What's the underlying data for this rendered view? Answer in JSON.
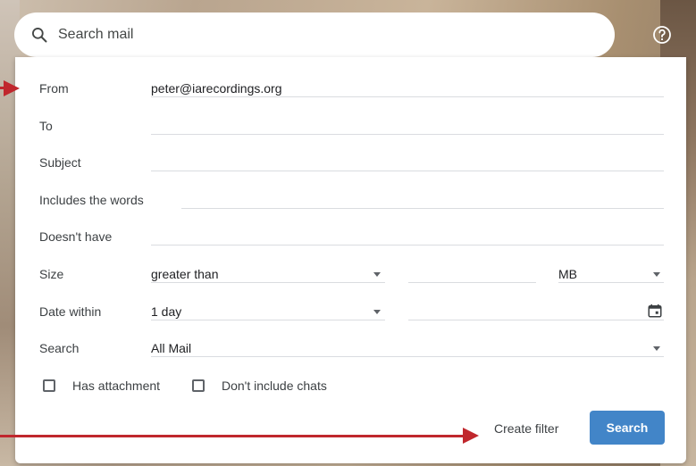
{
  "search": {
    "placeholder": "Search mail"
  },
  "form": {
    "from_label": "From",
    "from_value": "peter@iarecordings.org",
    "to_label": "To",
    "subject_label": "Subject",
    "includes_label": "Includes the words",
    "doesnt_have_label": "Doesn't have",
    "size_label": "Size",
    "size_operator": "greater than",
    "size_unit": "MB",
    "date_label": "Date within",
    "date_value": "1 day",
    "search_label": "Search",
    "search_scope": "All Mail",
    "has_attachment": "Has attachment",
    "no_chats": "Don't include chats",
    "create_filter": "Create filter",
    "search_button": "Search"
  },
  "colors": {
    "accent": "#4285c8",
    "annotation_arrow": "#c0272d"
  },
  "icons": [
    "search-icon",
    "help-icon",
    "calendar-icon",
    "chevron-down-icon"
  ]
}
